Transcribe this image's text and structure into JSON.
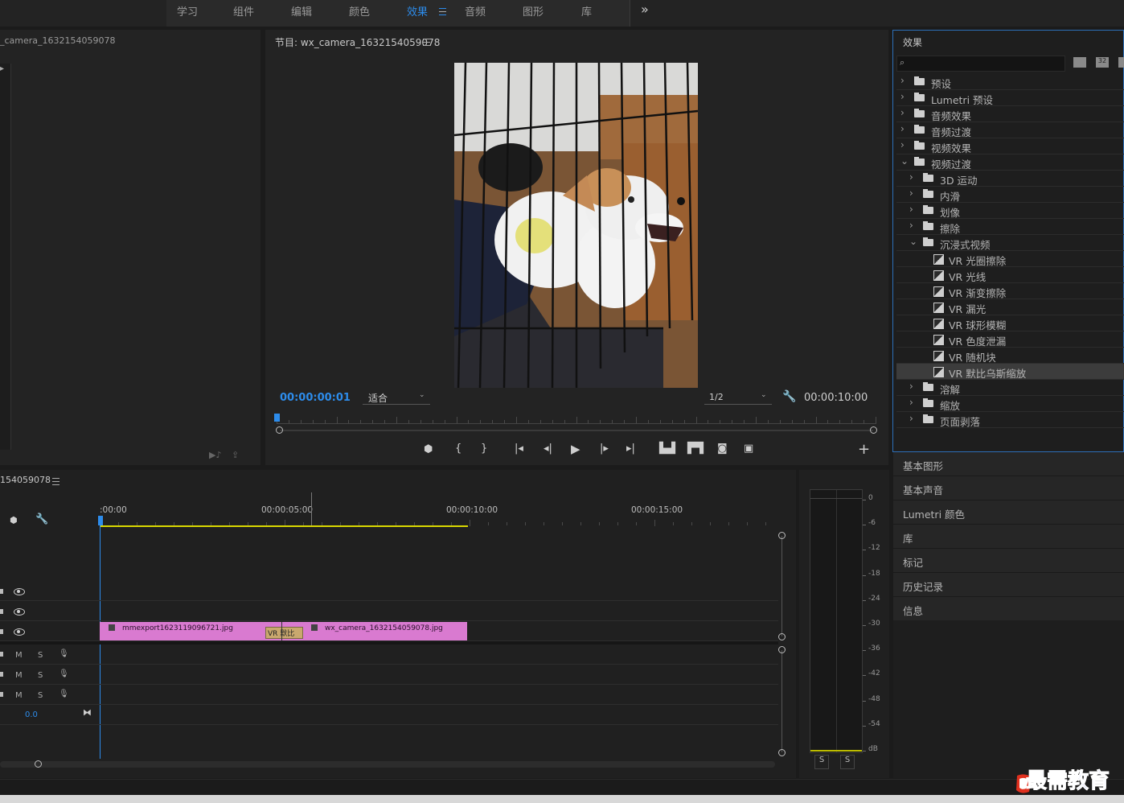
{
  "workspace_tabs": [
    "学习",
    "组件",
    "编辑",
    "颜色",
    "效果",
    "音频",
    "图形",
    "库"
  ],
  "overflow_label": "»",
  "source_panel": {
    "title": "_camera_1632154059078"
  },
  "program": {
    "title": "节目: wx_camera_1632154059078",
    "timecode": "00:00:00:01",
    "fit": "适合",
    "resolution": "1/2",
    "duration": "00:00:10:00"
  },
  "transport": {
    "add": "+"
  },
  "effects": {
    "title": "效果",
    "search_placeholder": "",
    "icons": [
      "accelerated-effects-icon",
      "32bit-icon",
      "yuv-icon"
    ],
    "items": [
      {
        "label": "预设",
        "level": 0,
        "kind": "preset-folder",
        "open": false
      },
      {
        "label": "Lumetri 预设",
        "level": 0,
        "kind": "preset-folder",
        "open": false
      },
      {
        "label": "音频效果",
        "level": 0,
        "kind": "folder",
        "open": false
      },
      {
        "label": "音频过渡",
        "level": 0,
        "kind": "folder",
        "open": false
      },
      {
        "label": "视频效果",
        "level": 0,
        "kind": "folder",
        "open": false
      },
      {
        "label": "视频过渡",
        "level": 0,
        "kind": "folder",
        "open": true
      },
      {
        "label": "3D 运动",
        "level": 1,
        "kind": "folder",
        "open": false
      },
      {
        "label": "内滑",
        "level": 1,
        "kind": "folder",
        "open": false
      },
      {
        "label": "划像",
        "level": 1,
        "kind": "folder",
        "open": false
      },
      {
        "label": "擦除",
        "level": 1,
        "kind": "folder",
        "open": false
      },
      {
        "label": "沉浸式视频",
        "level": 1,
        "kind": "folder",
        "open": true
      },
      {
        "label": "VR 光圈擦除",
        "level": 2,
        "kind": "effect"
      },
      {
        "label": "VR 光线",
        "level": 2,
        "kind": "effect"
      },
      {
        "label": "VR 渐变擦除",
        "level": 2,
        "kind": "effect"
      },
      {
        "label": "VR 漏光",
        "level": 2,
        "kind": "effect"
      },
      {
        "label": "VR 球形模糊",
        "level": 2,
        "kind": "effect"
      },
      {
        "label": "VR 色度泄漏",
        "level": 2,
        "kind": "effect"
      },
      {
        "label": "VR 随机块",
        "level": 2,
        "kind": "effect"
      },
      {
        "label": "VR 默比乌斯缩放",
        "level": 2,
        "kind": "effect",
        "selected": true
      },
      {
        "label": "溶解",
        "level": 1,
        "kind": "folder",
        "open": false
      },
      {
        "label": "缩放",
        "level": 1,
        "kind": "folder",
        "open": false
      },
      {
        "label": "页面剥落",
        "level": 1,
        "kind": "folder",
        "open": false
      }
    ]
  },
  "side_panels": [
    "基本图形",
    "基本声音",
    "Lumetri 颜色",
    "库",
    "标记",
    "历史记录",
    "信息"
  ],
  "timeline": {
    "title": "154059078",
    "ruler": [
      ":00:00",
      "00:00:05:00",
      "00:00:10:00",
      "00:00:15:00"
    ],
    "clips": {
      "clip1": "mmexport1623119096721.jpg",
      "transition": "VR 默比",
      "clip2": "wx_camera_1632154059078.jpg"
    },
    "audio_buttons": {
      "m": "M",
      "s": "S"
    },
    "master_level": "0.0"
  },
  "meter": {
    "labels": [
      "0",
      "-6",
      "-12",
      "-18",
      "-24",
      "-30",
      "-36",
      "-42",
      "-48",
      "-54",
      "dB"
    ],
    "solo": [
      "S",
      "S"
    ]
  },
  "watermark": "最需教育"
}
